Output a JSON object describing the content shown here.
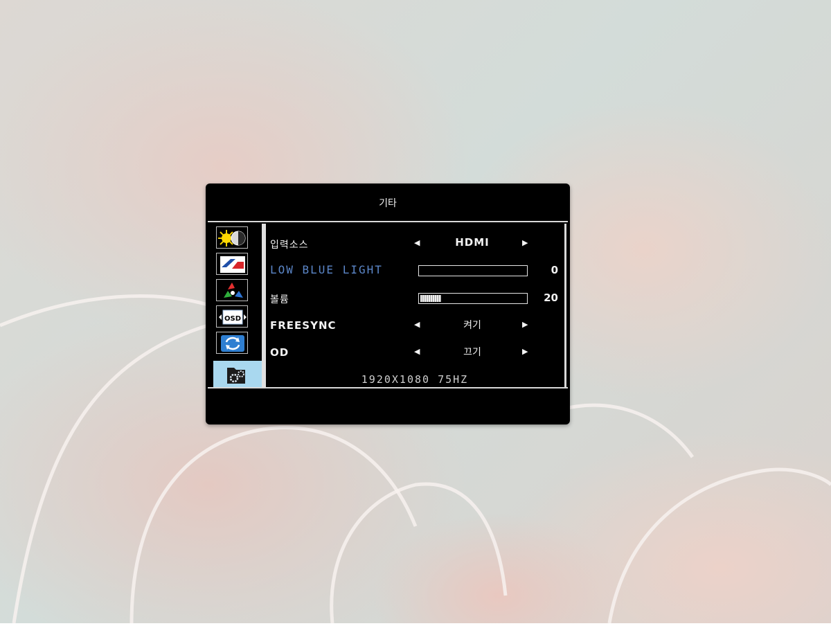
{
  "osd": {
    "title": "기타",
    "menu_icons": [
      {
        "name": "brightness-contrast-icon",
        "active": false
      },
      {
        "name": "image-icon",
        "active": false
      },
      {
        "name": "color-icon",
        "active": false
      },
      {
        "name": "osd-settings-icon",
        "active": false
      },
      {
        "name": "reset-icon",
        "active": false
      },
      {
        "name": "other-settings-icon",
        "active": true
      }
    ],
    "osd_icon_text": "OSD",
    "rows": [
      {
        "label": "입력소스",
        "type": "select",
        "value": "HDMI"
      },
      {
        "label": "LOW BLUE LIGHT",
        "type": "slider",
        "value": 0,
        "level": 0.0,
        "selected": true
      },
      {
        "label": "볼륨",
        "type": "slider",
        "value": 20,
        "level": 0.2
      },
      {
        "label": "FREESYNC",
        "type": "select",
        "value": "켜기"
      },
      {
        "label": "OD",
        "type": "select",
        "value": "끄기"
      }
    ],
    "resolution_text": "1920X1080 75HZ",
    "arrow_left": "◀",
    "arrow_right": "▶"
  },
  "colors": {
    "osd_background": "#000000",
    "selected_text": "#5b86c8",
    "active_tab": "#a9d8ef",
    "text": "#f2f2f2"
  }
}
